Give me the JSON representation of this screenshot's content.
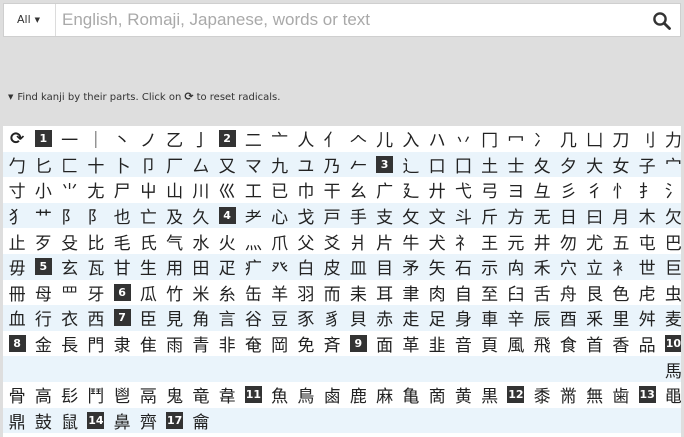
{
  "search": {
    "lang_label": "All",
    "placeholder": "English, Romaji, Japanese, words or text"
  },
  "hint": {
    "text_before": "Find kanji by their parts. Click on",
    "text_after": "to reset radicals."
  },
  "radicals": [
    [
      "⟳",
      "1",
      "一",
      "｜",
      "丶",
      "ノ",
      "乙",
      "亅",
      "2",
      "二",
      "亠",
      "人",
      "亻",
      "𠆢",
      "儿",
      "入",
      "ハ",
      "丷",
      "冂",
      "冖",
      "冫",
      "几",
      "凵",
      "刀",
      "刂",
      "力"
    ],
    [
      "勹",
      "匕",
      "匚",
      "十",
      "卜",
      "卩",
      "厂",
      "厶",
      "又",
      "マ",
      "九",
      "ユ",
      "乃",
      "𠂉",
      "3",
      "⻌",
      "口",
      "囗",
      "土",
      "士",
      "夂",
      "夕",
      "大",
      "女",
      "子",
      "宀"
    ],
    [
      "寸",
      "小",
      "⺌",
      "尢",
      "尸",
      "屮",
      "山",
      "川",
      "巛",
      "工",
      "已",
      "巾",
      "干",
      "幺",
      "广",
      "廴",
      "廾",
      "弋",
      "弓",
      "ヨ",
      "彑",
      "彡",
      "彳",
      "忄",
      "扌",
      "氵"
    ],
    [
      "犭",
      "艹",
      "阝",
      "阝",
      "也",
      "亡",
      "及",
      "久",
      "4",
      "耂",
      "心",
      "戈",
      "戸",
      "手",
      "支",
      "攵",
      "文",
      "斗",
      "斤",
      "方",
      "无",
      "日",
      "曰",
      "月",
      "木",
      "欠"
    ],
    [
      "止",
      "歹",
      "殳",
      "比",
      "毛",
      "氏",
      "气",
      "水",
      "火",
      "灬",
      "爪",
      "父",
      "爻",
      "爿",
      "片",
      "牛",
      "犬",
      "礻",
      "王",
      "元",
      "井",
      "勿",
      "尤",
      "五",
      "屯",
      "巴"
    ],
    [
      "毋",
      "5",
      "玄",
      "瓦",
      "甘",
      "生",
      "用",
      "田",
      "疋",
      "疒",
      "癶",
      "白",
      "皮",
      "皿",
      "目",
      "矛",
      "矢",
      "石",
      "示",
      "禸",
      "禾",
      "穴",
      "立",
      "衤",
      "世",
      "巨"
    ],
    [
      "冊",
      "母",
      "罒",
      "牙",
      "6",
      "瓜",
      "竹",
      "米",
      "糸",
      "缶",
      "羊",
      "羽",
      "而",
      "耒",
      "耳",
      "聿",
      "肉",
      "自",
      "至",
      "臼",
      "舌",
      "舟",
      "艮",
      "色",
      "虍",
      "虫"
    ],
    [
      "血",
      "行",
      "衣",
      "西",
      "7",
      "臣",
      "見",
      "角",
      "言",
      "谷",
      "豆",
      "豕",
      "豸",
      "貝",
      "赤",
      "走",
      "足",
      "身",
      "車",
      "辛",
      "辰",
      "酉",
      "釆",
      "里",
      "舛",
      "麦"
    ],
    [
      "8",
      "金",
      "長",
      "門",
      "隶",
      "隹",
      "雨",
      "青",
      "非",
      "奄",
      "岡",
      "免",
      "斉",
      "9",
      "面",
      "革",
      "韭",
      "音",
      "頁",
      "風",
      "飛",
      "食",
      "首",
      "香",
      "品",
      "10"
    ],
    [
      "",
      "",
      "",
      "",
      "",
      "",
      "",
      "",
      "",
      "",
      "",
      "",
      "",
      "",
      "",
      "",
      "",
      "",
      "",
      "",
      "",
      "",
      "",
      "",
      "",
      "馬"
    ],
    [
      "骨",
      "高",
      "髟",
      "鬥",
      "鬯",
      "鬲",
      "鬼",
      "竜",
      "韋",
      "11",
      "魚",
      "鳥",
      "鹵",
      "鹿",
      "麻",
      "亀",
      "啇",
      "黄",
      "黒",
      "12",
      "黍",
      "黹",
      "無",
      "歯",
      "13",
      "黽"
    ],
    [
      "鼎",
      "鼓",
      "鼠",
      "14",
      "鼻",
      "齊",
      "17",
      "龠"
    ]
  ]
}
